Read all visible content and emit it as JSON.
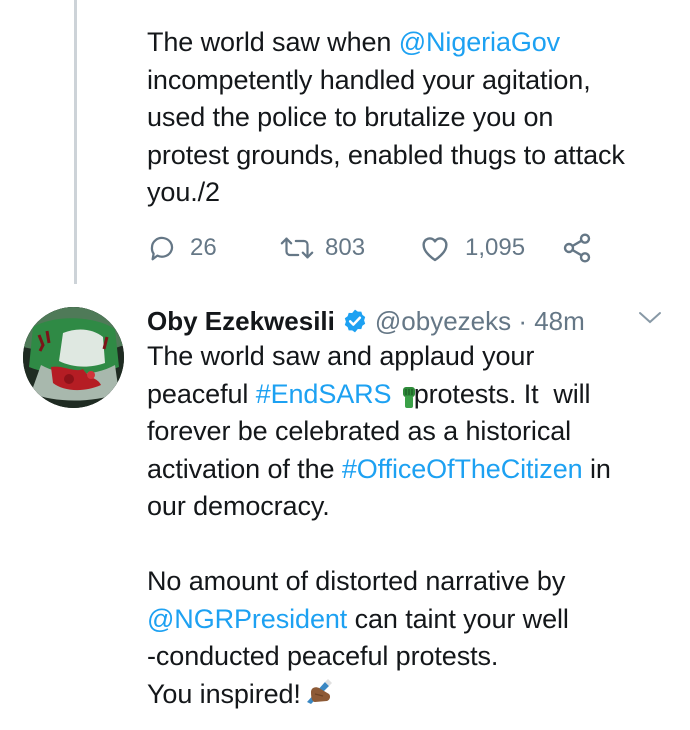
{
  "prev_tweet": {
    "lines": [
      {
        "pre": "The world saw when ",
        "link": "@NigeriaGov",
        "post": ""
      },
      {
        "pre": "incompetently handled your agitation,",
        "link": "",
        "post": ""
      },
      {
        "pre": "used the police to brutalize you on",
        "link": "",
        "post": ""
      },
      {
        "pre": "protest grounds, enabled thugs to attack",
        "link": "",
        "post": ""
      },
      {
        "pre": "you./2",
        "link": "",
        "post": ""
      }
    ],
    "reply_count": "26",
    "retweet_count": "803",
    "like_count": "1,095"
  },
  "tweet": {
    "name": "Oby Ezekwesili",
    "handle": "@obyezeks",
    "separator": " · ",
    "time": "48m",
    "lines": [
      {
        "pre": "The world saw and applaud your",
        "link": "",
        "post": ""
      },
      {
        "pre": "peaceful ",
        "link": "#EndSARS",
        "post": "   protests. It  will"
      },
      {
        "pre": "forever be celebrated as a historical",
        "link": "",
        "post": ""
      },
      {
        "pre": "activation of the ",
        "link": "#OfficeOfTheCitizen",
        "post": " in"
      },
      {
        "pre": "our democracy.",
        "link": "",
        "post": ""
      },
      {
        "pre": "",
        "link": "",
        "post": ""
      },
      {
        "pre": "No amount of distorted narrative by",
        "link": "",
        "post": ""
      },
      {
        "pre": "",
        "link": "@NGRPresident",
        "post": " can taint your well"
      },
      {
        "pre": "-conducted peaceful protests.",
        "link": "",
        "post": ""
      },
      {
        "pre": "You inspired!",
        "link": "",
        "post": ""
      }
    ]
  },
  "icons": {
    "reply": "reply-icon",
    "retweet": "retweet-icon",
    "like": "heart-icon",
    "share": "share-icon",
    "verified": "verified-badge-icon",
    "more": "chevron-down-icon",
    "fist_emoji": "raised-fist-emoji-icon",
    "writing_emoji": "writing-hand-emoji-icon"
  },
  "colors": {
    "link": "#1da1f2",
    "secondary_text": "#657786",
    "thread_line": "#cdd3d8",
    "text": "#14171a"
  }
}
